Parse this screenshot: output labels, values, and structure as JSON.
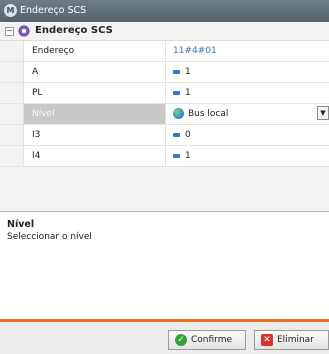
{
  "window": {
    "title": "Endereço SCS"
  },
  "property_group": {
    "label": "Endereço SCS"
  },
  "rows": [
    {
      "name": "Endereço",
      "value": "11#4#01",
      "icon": "none"
    },
    {
      "name": "A",
      "value": "1",
      "icon": "numeric"
    },
    {
      "name": "PL",
      "value": "1",
      "icon": "numeric"
    },
    {
      "name": "Nível",
      "value": "Bus local",
      "icon": "globe",
      "selected": true
    },
    {
      "name": "I3",
      "value": "0",
      "icon": "numeric"
    },
    {
      "name": "I4",
      "value": "1",
      "icon": "numeric"
    }
  ],
  "help": {
    "title": "Nível",
    "description": "Seleccionar o nível"
  },
  "buttons": {
    "confirm": "Confirme",
    "delete": "Eliminar"
  },
  "colors": {
    "accent": "#e8701e",
    "selected_row": "#c9c9c9",
    "link": "#3a6fbf"
  }
}
